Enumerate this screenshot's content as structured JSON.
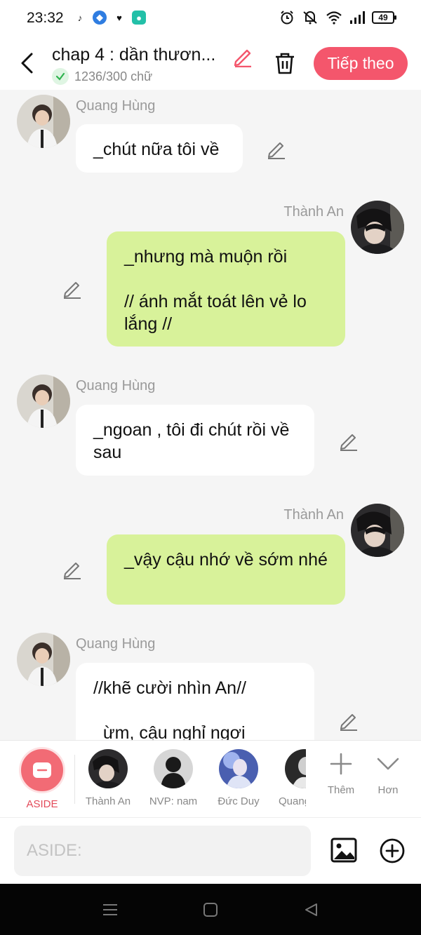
{
  "status_bar": {
    "time": "23:32",
    "battery": "49"
  },
  "header": {
    "title": "chap 4 : dần thươn...",
    "word_count": "1236/300 chữ",
    "next_label": "Tiếp theo",
    "accent_color": "#f4566c"
  },
  "messages": [
    {
      "side": "left",
      "name": "Quang Hùng",
      "text": "_chút nữa tôi về"
    },
    {
      "side": "right",
      "name": "Thành An",
      "text": "_nhưng mà muộn rồi\n\n// ánh mắt toát lên vẻ lo lắng //"
    },
    {
      "side": "left",
      "name": "Quang Hùng",
      "text": "_ngoan , tôi đi chút rồi về sau"
    },
    {
      "side": "right",
      "name": "Thành An",
      "text": "_vậy cậu nhớ về sớm nhé"
    },
    {
      "side": "left",
      "name": "Quang Hùng",
      "text": "//khẽ cười nhìn An//\n\n_ừm, cậu nghỉ ngơi"
    }
  ],
  "characters": [
    {
      "label": "ASIDE"
    },
    {
      "label": "Thành An"
    },
    {
      "label": "NVP: nam"
    },
    {
      "label": "Đức Duy"
    },
    {
      "label": "Quang Hùng"
    }
  ],
  "tools": {
    "more_label": "Thêm",
    "less_label": "Hơn"
  },
  "input": {
    "placeholder": "ASIDE:"
  }
}
